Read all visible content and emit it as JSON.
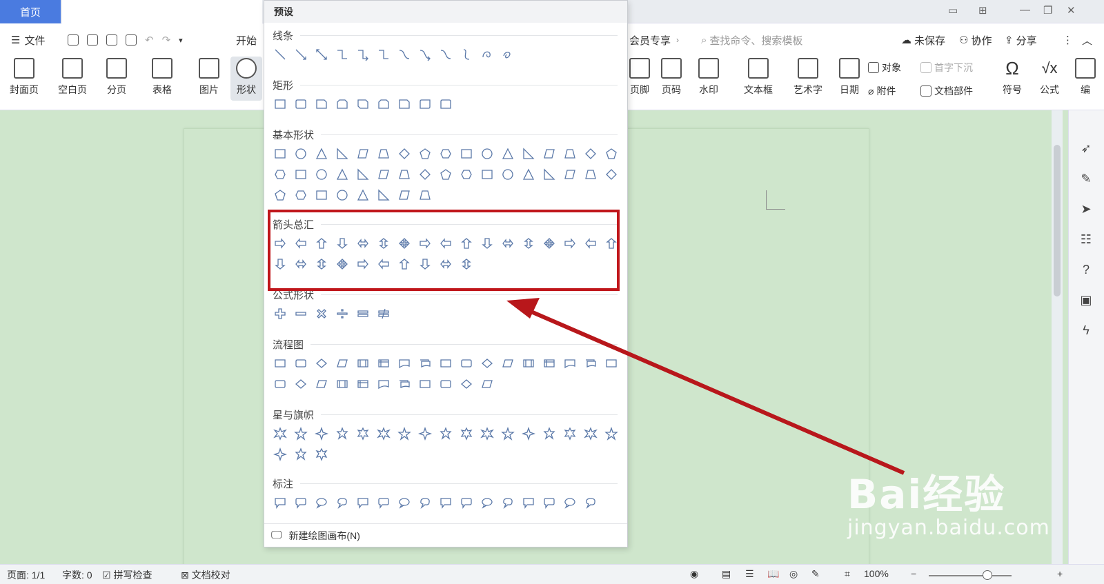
{
  "titlebar": {
    "home_tab": "首页"
  },
  "menu": {
    "file": "文件",
    "start": "开始",
    "vip": "会员专享",
    "search_placeholder": "查找命令、搜索模板",
    "unsaved": "未保存",
    "collab": "协作",
    "share": "分享"
  },
  "ribbon_left": [
    {
      "name": "cover-page",
      "label": "封面页"
    },
    {
      "name": "blank-page",
      "label": "空白页"
    },
    {
      "name": "page-break",
      "label": "分页"
    },
    {
      "name": "table",
      "label": "表格"
    },
    {
      "name": "picture",
      "label": "图片"
    },
    {
      "name": "shapes",
      "label": "形状"
    }
  ],
  "ribbon_right": [
    {
      "name": "header-footer",
      "label": "页眉页脚",
      "display": "页脚"
    },
    {
      "name": "page-number",
      "label": "页码"
    },
    {
      "name": "watermark",
      "label": "水印"
    },
    {
      "name": "textbox",
      "label": "文本框"
    },
    {
      "name": "wordart",
      "label": "艺术字"
    },
    {
      "name": "date",
      "label": "日期"
    },
    {
      "name": "symbol",
      "label": "符号"
    },
    {
      "name": "formula",
      "label": "公式"
    },
    {
      "name": "edit",
      "label": "编"
    }
  ],
  "ribbon_small": {
    "object": "对象",
    "dropcap": "首字下沉",
    "attachment": "附件",
    "doc_parts": "文档部件"
  },
  "panel": {
    "title": "预设",
    "categories": [
      "线条",
      "矩形",
      "基本形状",
      "箭头总汇",
      "公式形状",
      "流程图",
      "星与旗帜",
      "标注"
    ],
    "footer": "新建绘图画布(N)"
  },
  "status": {
    "page": "页面: 1/1",
    "words": "字数: 0",
    "spell": "拼写检查",
    "proof": "文档校对",
    "zoom": "100%"
  },
  "watermark": {
    "brand": "Bai经验",
    "url": "jingyan.baidu.com"
  },
  "colors": {
    "accent": "#4a7be0",
    "highlight": "#c0161b",
    "page_bg": "#cfe6cc",
    "shape_stroke": "#5a78a8"
  }
}
